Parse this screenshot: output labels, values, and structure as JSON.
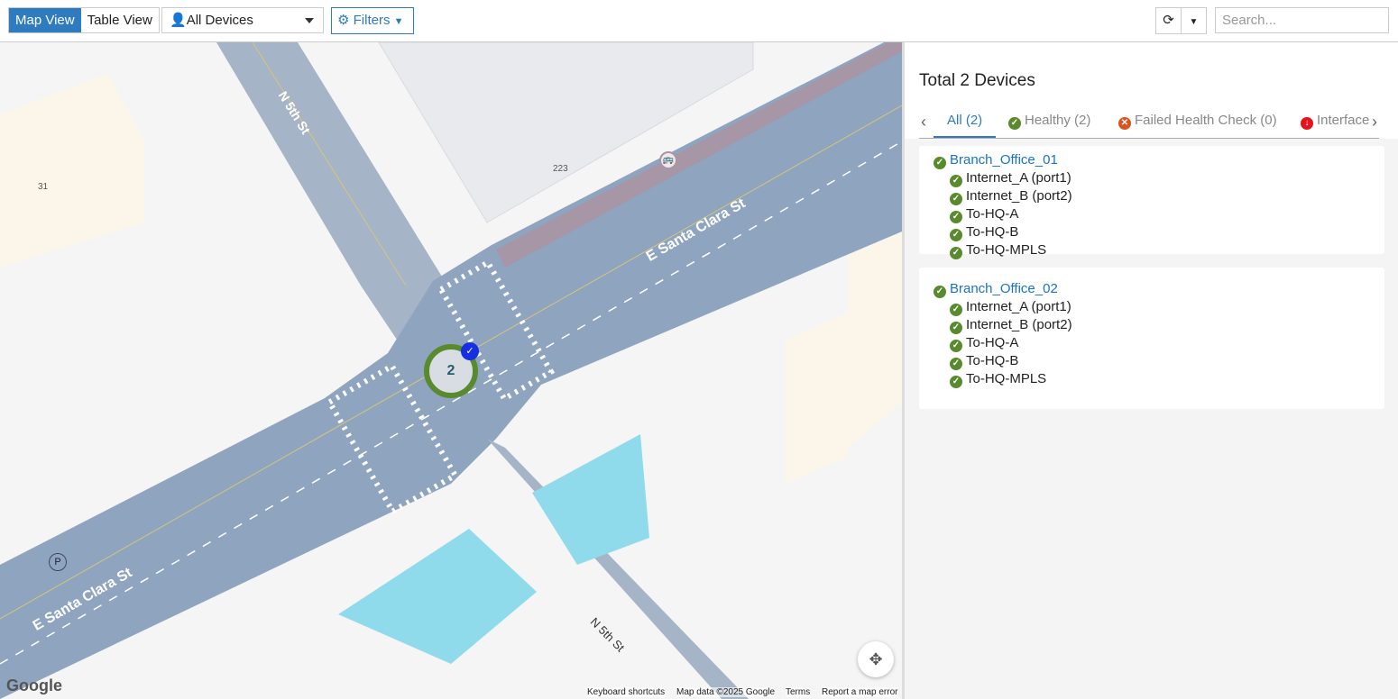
{
  "toolbar": {
    "map_view": "Map View",
    "table_view": "Table View",
    "device_select": "All Devices",
    "filters": "Filters",
    "refresh_icon": "refresh-icon",
    "search_placeholder": "Search..."
  },
  "map": {
    "streets": [
      "N 5th St",
      "E Santa Clara St",
      "E Santa Clara St",
      "N 5th St"
    ],
    "labels": {
      "building_223": "223",
      "building_31": "31",
      "parking": "P"
    },
    "cluster_count": "2",
    "attribution": {
      "google": "Google",
      "shortcuts": "Keyboard shortcuts",
      "map_data": "Map data ©2025 Google",
      "terms": "Terms",
      "report": "Report a map error"
    }
  },
  "panel": {
    "title": "Total 2 Devices",
    "tabs": [
      {
        "label": "All (2)"
      },
      {
        "label": "Healthy (2)"
      },
      {
        "label": "Failed Health Check (0)"
      },
      {
        "label": "Interface"
      }
    ],
    "devices": [
      {
        "name": "Branch_Office_01",
        "interfaces": [
          "Internet_A (port1)",
          "Internet_B (port2)",
          "To-HQ-A",
          "To-HQ-B",
          "To-HQ-MPLS"
        ]
      },
      {
        "name": "Branch_Office_02",
        "interfaces": [
          "Internet_A (port1)",
          "Internet_B (port2)",
          "To-HQ-A",
          "To-HQ-B",
          "To-HQ-MPLS"
        ]
      }
    ]
  },
  "colors": {
    "accent": "#2f7bbf",
    "healthy": "#5a8a2e",
    "failed": "#d9541e",
    "interface_down": "#e3141b",
    "road": "#8ea4bf"
  }
}
